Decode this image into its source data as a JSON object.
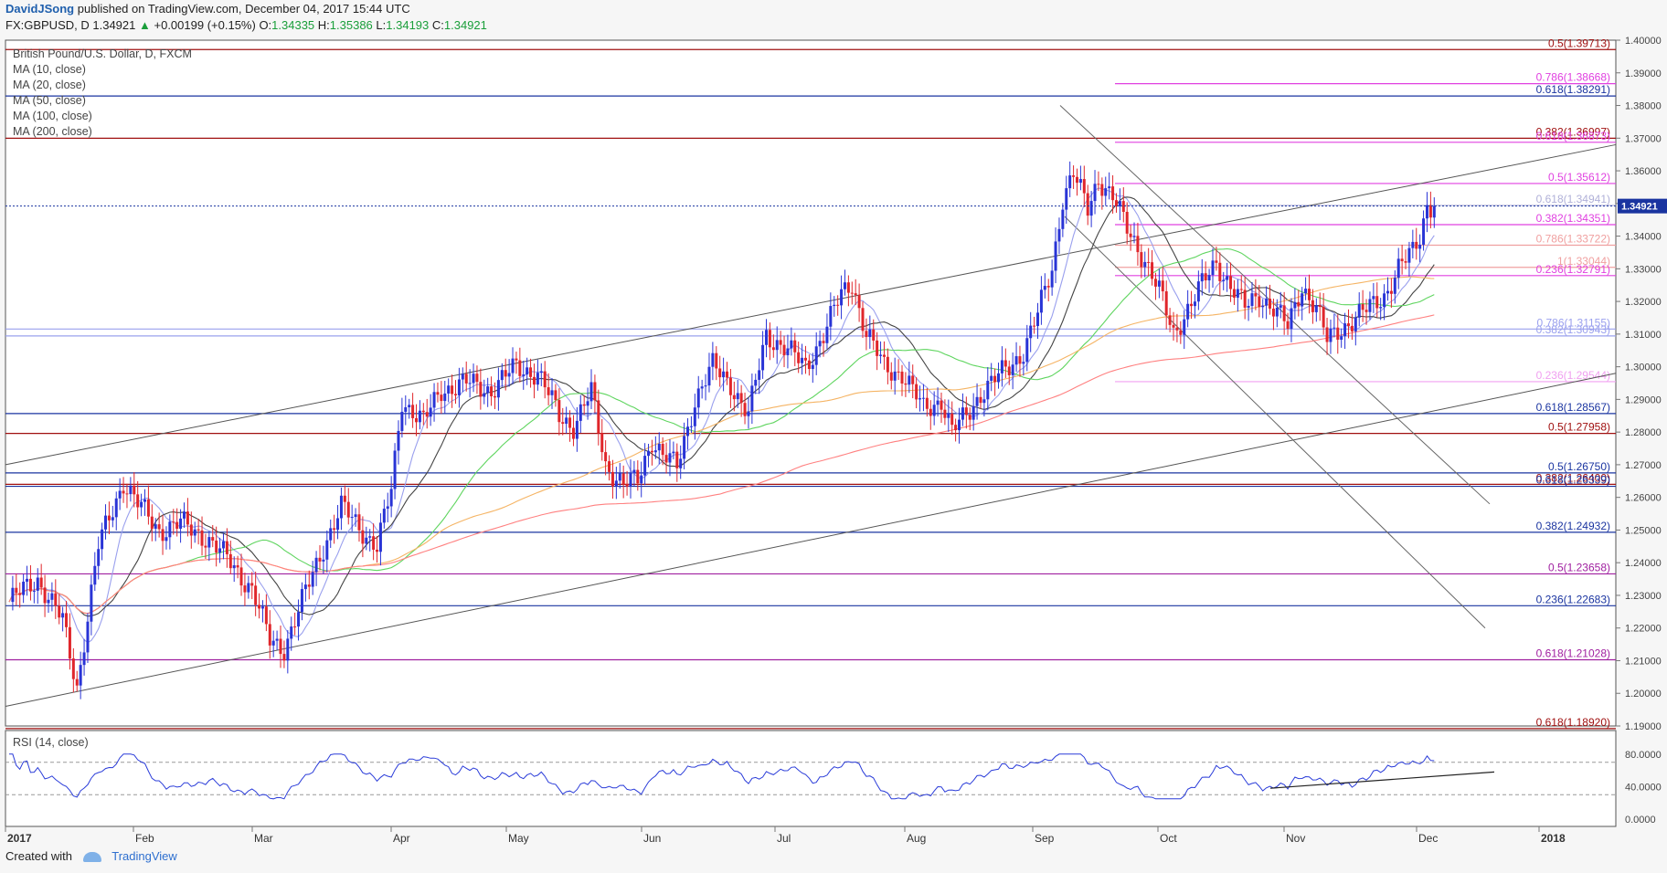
{
  "header": {
    "author": "DavidJSong",
    "published_text": "published on TradingView.com, December 04, 2017 15:44 UTC",
    "symbol": "FX:GBPUSD, D",
    "last": "1.34921",
    "change": "+0.00199 (+0.15%)",
    "o_label": "O:",
    "o": "1.34335",
    "h_label": "H:",
    "h": "1.35386",
    "l_label": "L:",
    "l": "1.34193",
    "c_label": "C:",
    "c": "1.34921"
  },
  "legend": [
    "British Pound/U.S. Dollar, D, FXCM",
    "MA (10, close)",
    "MA (20, close)",
    "MA (50, close)",
    "MA (100, close)",
    "MA (200, close)"
  ],
  "rsi_label": "RSI (14, close)",
  "footer": {
    "created_with": "Created with",
    "brand": "TradingView"
  },
  "colors": {
    "up": "#2934d6",
    "down": "#e0262b",
    "ma10": "#9aa0ee",
    "ma20": "#444444",
    "ma50": "#5fd55f",
    "ma100": "#f5b464",
    "ma200": "#ff8080",
    "rsi": "#2a3cd9",
    "current": "#1a34a0",
    "magenta": "#e040e0"
  },
  "chart_data": {
    "type": "candlestick",
    "ylim": [
      1.19,
      1.4
    ],
    "y_ticks": [
      "1.40000",
      "1.39000",
      "1.38000",
      "1.37000",
      "1.36000",
      "1.35000",
      "1.34000",
      "1.33000",
      "1.32000",
      "1.31000",
      "1.30000",
      "1.29000",
      "1.28000",
      "1.27000",
      "1.26000",
      "1.25000",
      "1.24000",
      "1.23000",
      "1.22000",
      "1.21000",
      "1.20000",
      "1.19000"
    ],
    "x_labels": [
      "2017",
      "Feb",
      "Mar",
      "Apr",
      "May",
      "Jun",
      "Jul",
      "Aug",
      "Sep",
      "Oct",
      "Nov",
      "Dec",
      "2018"
    ],
    "current_price": "1.34921",
    "fib_levels": [
      {
        "label": "0.5(1.39713)",
        "value": 1.39713,
        "color": "#a01010"
      },
      {
        "label": "0.786(1.38668)",
        "value": 1.38668,
        "color": "#e040e0"
      },
      {
        "label": "0.618(1.38291)",
        "value": 1.38291,
        "color": "#1a34a0"
      },
      {
        "label": "0.382(1.36997)",
        "value": 1.36997,
        "color": "#a01010"
      },
      {
        "label": "0.618(1.36873)",
        "value": 1.36873,
        "color": "#e040e0"
      },
      {
        "label": "0.5(1.35612)",
        "value": 1.35612,
        "color": "#e040e0"
      },
      {
        "label": "0.618(1.34941)",
        "value": 1.34941,
        "color": "#b0b0d8"
      },
      {
        "label": "0.382(1.34351)",
        "value": 1.34351,
        "color": "#e040e0"
      },
      {
        "label": "0.786(1.33722)",
        "value": 1.33722,
        "color": "#f0a0a0"
      },
      {
        "label": "1(1.33044)",
        "value": 1.33044,
        "color": "#f0a0a0"
      },
      {
        "label": "0.236(1.32791)",
        "value": 1.32791,
        "color": "#e040e0"
      },
      {
        "label": "0.786(1.31155)",
        "value": 1.31155,
        "color": "#9aa0ee"
      },
      {
        "label": "0.382(1.30943)",
        "value": 1.30943,
        "color": "#9aa0ee"
      },
      {
        "label": "0.236(1.29544)",
        "value": 1.29544,
        "color": "#f0a0f0"
      },
      {
        "label": "0.618(1.28567)",
        "value": 1.28567,
        "color": "#1a34a0"
      },
      {
        "label": "0.5(1.27958)",
        "value": 1.27958,
        "color": "#a01010"
      },
      {
        "label": "0.5(1.26750)",
        "value": 1.2675,
        "color": "#1a34a0"
      },
      {
        "label": "0.382(1.26400)",
        "value": 1.264,
        "color": "#a01010"
      },
      {
        "label": "0.618(1.26339)",
        "value": 1.26339,
        "color": "#1a34a0"
      },
      {
        "label": "0.382(1.24932)",
        "value": 1.24932,
        "color": "#1a34a0"
      },
      {
        "label": "0.5(1.23658)",
        "value": 1.23658,
        "color": "#a020a0"
      },
      {
        "label": "0.236(1.22683)",
        "value": 1.22683,
        "color": "#1a34a0"
      },
      {
        "label": "0.618(1.21028)",
        "value": 1.21028,
        "color": "#a020a0"
      },
      {
        "label": "0.618(1.18920)",
        "value": 1.1892,
        "color": "#a01010"
      }
    ],
    "fib_label_text": [
      "0.5(1.39713)",
      "0.786(1.38668)",
      "0.618(1.38291)",
      "0.382(1.36997)",
      "0.618(1.36873)",
      "0.5(1.35612)",
      "0.618(1.34941)",
      "0.382(1.34351)",
      "0.786(1.33722)",
      "1(1.33044)",
      "0.236(1.32791)",
      "0.786(1.31155)",
      "0.382(1.30943)",
      "0.236(1.29544)",
      "0.618(1.28567)",
      "0.5(1.27958)",
      "0.5(1.26750)",
      "0.382(1.26400)",
      "0.618(1.26339)",
      "0.382(1.24932)",
      "0.5(1.23658)",
      "0.236(1.22683)",
      "0.618(1.21028)",
      "0.618(1.18920)"
    ],
    "rsi_ticks": [
      "80.0000",
      "40.0000",
      "0.0000"
    ],
    "anchors": [
      [
        0,
        1.228
      ],
      [
        8,
        1.235
      ],
      [
        15,
        1.222
      ],
      [
        19,
        1.202
      ],
      [
        25,
        1.245
      ],
      [
        32,
        1.265
      ],
      [
        36,
        1.258
      ],
      [
        42,
        1.25
      ],
      [
        48,
        1.252
      ],
      [
        55,
        1.248
      ],
      [
        62,
        1.24
      ],
      [
        68,
        1.232
      ],
      [
        73,
        1.216
      ],
      [
        77,
        1.214
      ],
      [
        82,
        1.228
      ],
      [
        88,
        1.245
      ],
      [
        93,
        1.257
      ],
      [
        98,
        1.251
      ],
      [
        103,
        1.245
      ],
      [
        107,
        1.262
      ],
      [
        110,
        1.29
      ],
      [
        116,
        1.283
      ],
      [
        121,
        1.293
      ],
      [
        128,
        1.295
      ],
      [
        135,
        1.293
      ],
      [
        142,
        1.3
      ],
      [
        148,
        1.298
      ],
      [
        154,
        1.285
      ],
      [
        158,
        1.282
      ],
      [
        163,
        1.292
      ],
      [
        167,
        1.27
      ],
      [
        172,
        1.264
      ],
      [
        176,
        1.265
      ],
      [
        180,
        1.278
      ],
      [
        183,
        1.273
      ],
      [
        187,
        1.269
      ],
      [
        192,
        1.29
      ],
      [
        197,
        1.3
      ],
      [
        202,
        1.295
      ],
      [
        207,
        1.285
      ],
      [
        212,
        1.31
      ],
      [
        217,
        1.306
      ],
      [
        223,
        1.3
      ],
      [
        228,
        1.31
      ],
      [
        233,
        1.322
      ],
      [
        236,
        1.326
      ],
      [
        240,
        1.31
      ],
      [
        245,
        1.3
      ],
      [
        250,
        1.298
      ],
      [
        256,
        1.287
      ],
      [
        261,
        1.29
      ],
      [
        264,
        1.28
      ],
      [
        268,
        1.285
      ],
      [
        272,
        1.292
      ],
      [
        276,
        1.296
      ],
      [
        280,
        1.3
      ],
      [
        284,
        1.305
      ],
      [
        288,
        1.316
      ],
      [
        292,
        1.33
      ],
      [
        295,
        1.352
      ],
      [
        298,
        1.359
      ],
      [
        302,
        1.348
      ],
      [
        305,
        1.358
      ],
      [
        309,
        1.352
      ],
      [
        313,
        1.342
      ],
      [
        318,
        1.333
      ],
      [
        322,
        1.323
      ],
      [
        326,
        1.31
      ],
      [
        330,
        1.318
      ],
      [
        334,
        1.325
      ],
      [
        338,
        1.332
      ],
      [
        342,
        1.325
      ],
      [
        346,
        1.318
      ],
      [
        350,
        1.322
      ],
      [
        354,
        1.318
      ],
      [
        358,
        1.312
      ],
      [
        362,
        1.325
      ],
      [
        366,
        1.318
      ],
      [
        369,
        1.308
      ],
      [
        373,
        1.312
      ],
      [
        377,
        1.315
      ],
      [
        381,
        1.318
      ],
      [
        385,
        1.322
      ],
      [
        389,
        1.33
      ],
      [
        393,
        1.335
      ],
      [
        395,
        1.34
      ],
      [
        397,
        1.35
      ],
      [
        399,
        1.349
      ]
    ]
  }
}
